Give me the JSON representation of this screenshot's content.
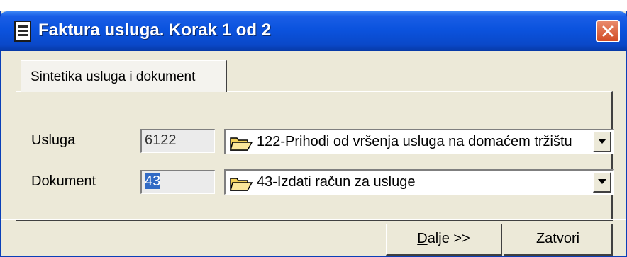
{
  "window": {
    "title": "Faktura usluga. Korak 1 od 2",
    "app_icon": "ledger-icon",
    "close_icon": "close-icon"
  },
  "tab": {
    "label": "Sintetika usluga i dokument"
  },
  "fields": [
    {
      "label": "Usluga",
      "code": "6122",
      "selected": "122-Prihodi od vršenja usluga na domaćem tržištu",
      "icon": "folder-open-icon"
    },
    {
      "label": "Dokument",
      "code": "43",
      "selected": "43-Izdati račun za usluge",
      "icon": "folder-open-icon"
    }
  ],
  "buttons": {
    "next_mnemonic": "D",
    "next_rest": "alje >>",
    "close": "Zatvori"
  },
  "colors": {
    "title_bar": "#0b53de",
    "close_button": "#d24d25",
    "dialog_bg": "#ece9d8",
    "selection": "#316ac5"
  }
}
